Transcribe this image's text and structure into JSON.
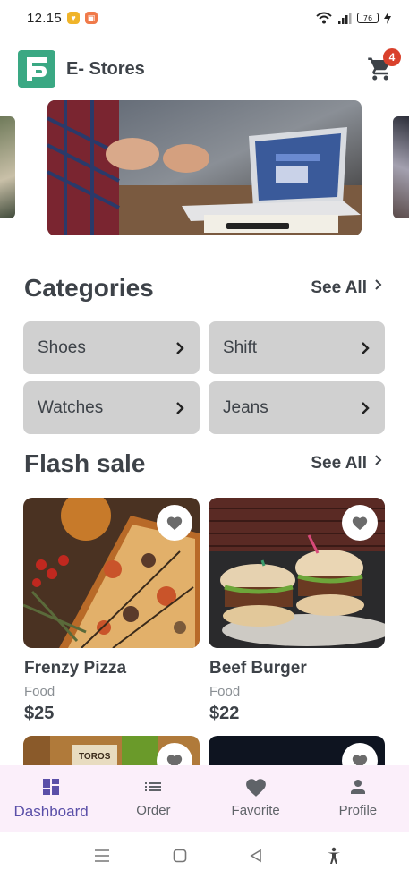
{
  "status_bar": {
    "time": "12.15",
    "battery": "76"
  },
  "app": {
    "title": "E- Stores",
    "logo_letter": "B",
    "cart_count": "4"
  },
  "categories": {
    "heading": "Categories",
    "see_all": "See All",
    "items": [
      {
        "label": "Shoes"
      },
      {
        "label": "Shift"
      },
      {
        "label": "Watches"
      },
      {
        "label": "Jeans"
      }
    ]
  },
  "flash_sale": {
    "heading": "Flash sale",
    "see_all": "See All",
    "products": [
      {
        "name": "Frenzy Pizza",
        "category": "Food",
        "price": "$25"
      },
      {
        "name": "Beef Burger",
        "category": "Food",
        "price": "$22"
      }
    ],
    "partial_product_label": "TOROS"
  },
  "bottom_nav": {
    "items": [
      {
        "label": "Dashboard",
        "icon": "dashboard-icon",
        "active": true
      },
      {
        "label": "Order",
        "icon": "list-icon",
        "active": false
      },
      {
        "label": "Favorite",
        "icon": "heart-icon",
        "active": false
      },
      {
        "label": "Profile",
        "icon": "person-icon",
        "active": false
      }
    ]
  },
  "colors": {
    "brand_green": "#3aa883",
    "badge_red": "#d9412c",
    "active_nav": "#5a4fa8",
    "nav_bg": "#fbeffa",
    "category_bg": "#d0d0d0"
  }
}
